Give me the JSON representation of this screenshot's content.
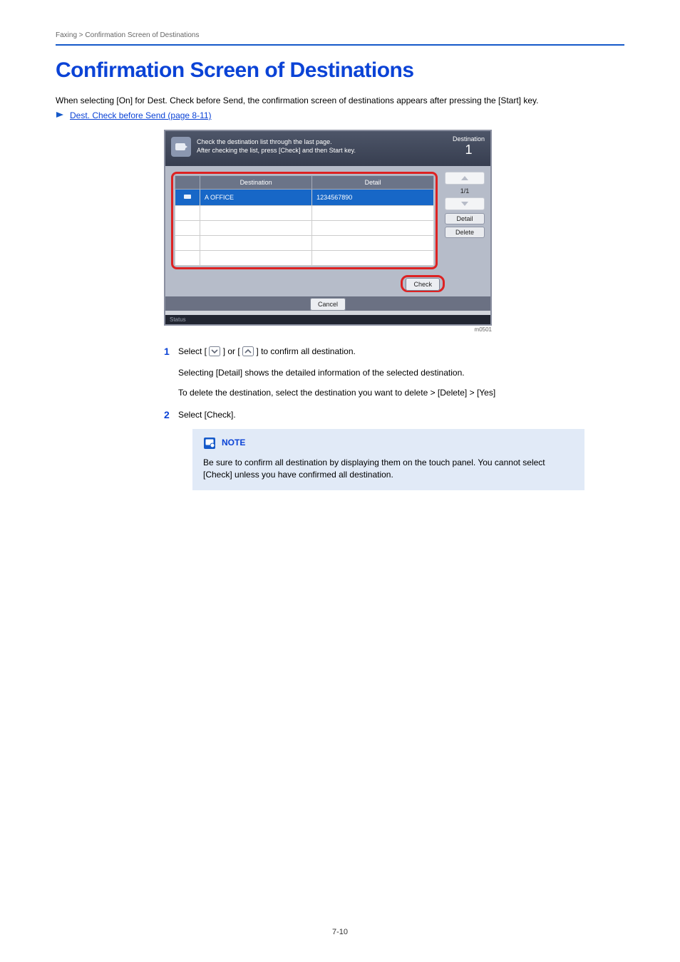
{
  "running_head": {
    "left": "Faxing > Confirmation Screen of Destinations",
    "right": ""
  },
  "title": "Confirmation Screen of Destinations",
  "intro": "When selecting [On] for Dest. Check before Send, the confirmation screen of destinations appears after pressing the [Start] key.",
  "xref": {
    "label": "Dest. Check before Send (page 8-11)"
  },
  "panel": {
    "msg_line1": "Check the destination list through the last page.",
    "msg_line2": "After checking the list, press [Check] and then Start key.",
    "dest_label": "Destination",
    "dest_count": "1",
    "col_destination": "Destination",
    "col_detail": "Detail",
    "row_name": "A OFFICE",
    "row_detail": "1234567890",
    "pager": "1/1",
    "btn_detail": "Detail",
    "btn_delete": "Delete",
    "btn_check": "Check",
    "btn_cancel": "Cancel",
    "status_left": "Status",
    "status_right": "m0501"
  },
  "steps": {
    "s1_a": "Select [",
    "s1_b": "] or [",
    "s1_c": "] to confirm all destination.",
    "s1_p2": "Selecting [Detail] shows the detailed information of the selected destination.",
    "s1_p3": "To delete the destination, select the destination you want to delete > [Delete] > [Yes]",
    "s2": "Select [Check]."
  },
  "note": {
    "head": "NOTE",
    "body": "Be sure to confirm all destination by displaying them on the touch panel. You cannot select [Check] unless you have confirmed all destination."
  },
  "page_no": "7-10"
}
